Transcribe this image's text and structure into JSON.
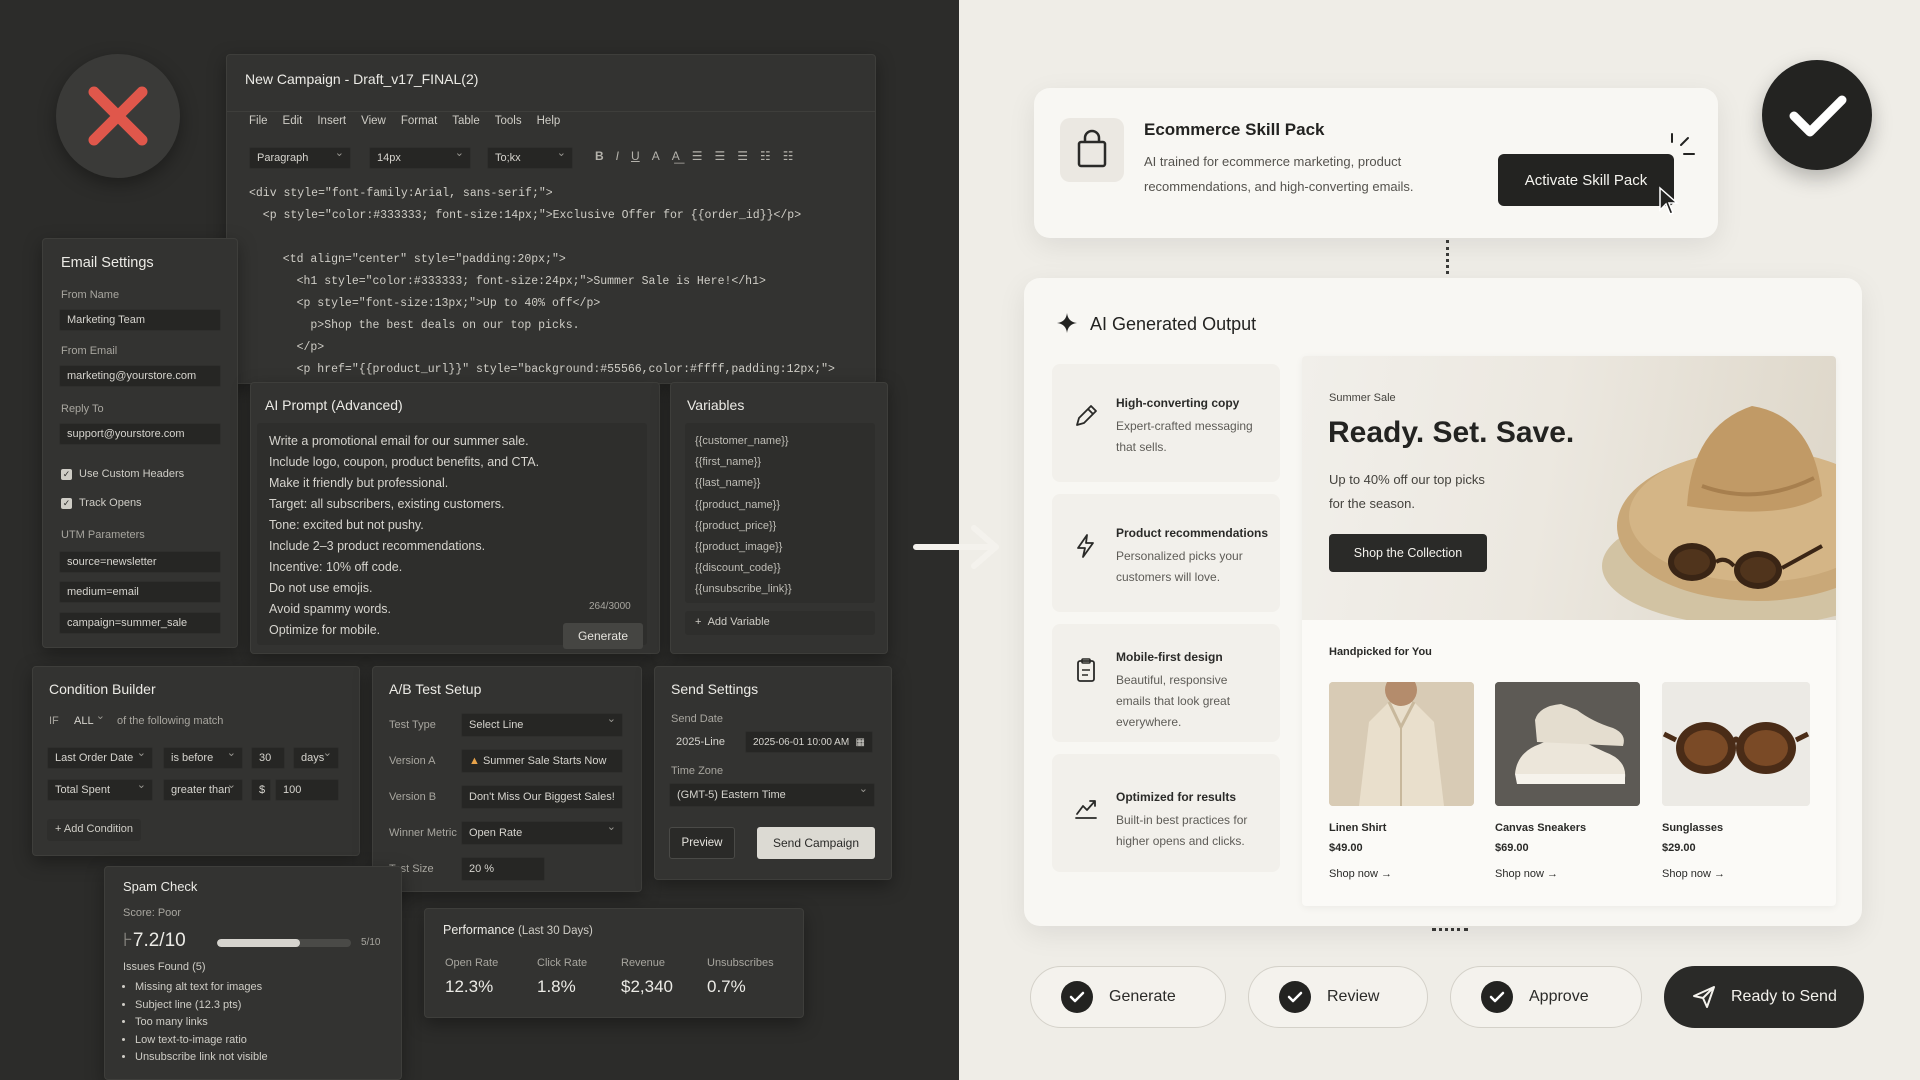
{
  "editor": {
    "title": "New Campaign - Draft_v17_FINAL(2)",
    "menu": [
      "File",
      "Edit",
      "Insert",
      "View",
      "Format",
      "Table",
      "Tools",
      "Help"
    ],
    "toolbar": {
      "paragraph": "Paragraph",
      "size": "14px",
      "font": "To;kx"
    },
    "code_lines": [
      "<div style=\"font-family:Arial, sans-serif;\">",
      "  <p style=\"color:#333333; font-size:14px;\">Exclusive Offer for {{order_id}}</p>",
      "",
      "  <td align=\"center\" style=\"padding:20px;\">",
      "    <h1 style=\"color:#333333; font-size:24px;\">Summer Sale is Here!</h1>",
      "    <p style=\"font-size:13px;\">Up to 40% off</p>",
      "      p>Shop the best deals on our top picks.",
      "    </p>",
      "    <p href=\"{{product_url}}\" style=\"background:#55566,color:#ffff,padding:12px;\">"
    ]
  },
  "email_settings": {
    "title": "Email Settings",
    "from_name_label": "From Name",
    "from_name": "Marketing Team",
    "from_email_label": "From Email",
    "from_email": "marketing@yourstore.com",
    "reply_to_label": "Reply To",
    "reply_to": "support@yourstore.com",
    "custom_headers": "Use Custom Headers",
    "track_opens": "Track Opens",
    "utm_label": "UTM Parameters",
    "utm": [
      "source=newsletter",
      "medium=email",
      "campaign=summer_sale"
    ]
  },
  "ai_prompt": {
    "title": "AI Prompt (Advanced)",
    "lines": [
      "Write a promotional email for our summer sale.",
      "Include logo, coupon, product benefits, and CTA.",
      "Make it friendly but professional.",
      "Target: all subscribers, existing customers.",
      "Tone: excited but not pushy.",
      "Include 2–3 product recommendations.",
      "Incentive: 10% off code.",
      "Do not use emojis.",
      "Avoid spammy words.",
      "Optimize for mobile."
    ],
    "counter": "264/3000",
    "generate": "Generate"
  },
  "variables": {
    "title": "Variables",
    "items": [
      "{{customer_name}}",
      "{{first_name}}",
      "{{last_name}}",
      "{{product_name}}",
      "{{product_price}}",
      "{{product_image}}",
      "{{discount_code}}",
      "{{unsubscribe_link}}"
    ],
    "add": "Add Variable"
  },
  "condition_builder": {
    "title": "Condition Builder",
    "if": "IF",
    "all": "ALL",
    "match": "of the following match",
    "row1": [
      "Last Order Date",
      "is before",
      "30",
      "days"
    ],
    "row2": [
      "Total Spent",
      "greater than",
      "$",
      "100"
    ],
    "add": "Add Condition"
  },
  "ab_test": {
    "title": "A/B Test Setup",
    "test_type_label": "Test Type",
    "test_type": "Select Line",
    "version_a_label": "Version A",
    "version_a": "Summer Sale Starts Now",
    "version_b_label": "Version B",
    "version_b": "Don't Miss Our Biggest Sales!",
    "metric_label": "Winner Metric",
    "metric": "Open Rate",
    "size_label": "Test Size",
    "size": "20 %"
  },
  "send_settings": {
    "title": "Send Settings",
    "send_date_label": "Send Date",
    "send_line": "2025-Line",
    "datetime": "2025-06-01 10:00 AM",
    "tz_label": "Time Zone",
    "tz": "(GMT-5) Eastern Time",
    "preview": "Preview",
    "send": "Send Campaign"
  },
  "spam": {
    "title": "Spam Check",
    "score_label": "Score: Poor",
    "score": "7.2/10",
    "bar_marker": "5/10",
    "bar_fill": 0.62,
    "issues_title": "Issues Found (5)",
    "issues": [
      "Missing alt text for images",
      "Subject line (12.3 pts)",
      "Too many links",
      "Low text-to-image ratio",
      "Unsubscribe link not visible"
    ]
  },
  "performance": {
    "title": "Performance",
    "period": "(Last 30 Days)",
    "metrics": [
      {
        "label": "Open Rate",
        "value": "12.3%"
      },
      {
        "label": "Click Rate",
        "value": "1.8%"
      },
      {
        "label": "Revenue",
        "value": "$2,340"
      },
      {
        "label": "Unsubscribes",
        "value": "0.7%"
      }
    ]
  },
  "skill_pack": {
    "title": "Ecommerce Skill Pack",
    "desc1": "AI trained for ecommerce marketing, product",
    "desc2": "recommendations, and high-converting emails.",
    "activate": "Activate Skill Pack"
  },
  "output": {
    "title": "AI Generated Output",
    "features": [
      {
        "title": "High-converting copy",
        "lines": [
          "Expert-crafted messaging",
          "that sells."
        ]
      },
      {
        "title": "Product recommendations",
        "lines": [
          "Personalized picks your",
          "customers will love."
        ]
      },
      {
        "title": "Mobile-first design",
        "lines": [
          "Beautiful, responsive",
          "emails that look great",
          "everywhere."
        ]
      },
      {
        "title": "Optimized for results",
        "lines": [
          "Built-in best practices for",
          "higher opens and clicks."
        ]
      }
    ],
    "hero": {
      "kicker": "Summer Sale",
      "headline": "Ready. Set. Save.",
      "sub1": "Up to 40% off our top picks",
      "sub2": "for the season.",
      "cta": "Shop the Collection"
    },
    "handpicked": "Handpicked for You",
    "products": [
      {
        "name": "Linen Shirt",
        "price": "$49.00",
        "link": "Shop now →"
      },
      {
        "name": "Canvas Sneakers",
        "price": "$69.00",
        "link": "Shop now →"
      },
      {
        "name": "Sunglasses",
        "price": "$29.00",
        "link": "Shop now →"
      }
    ]
  },
  "workflow": {
    "steps": [
      "Generate",
      "Review",
      "Approve"
    ],
    "final": "Ready to Send"
  },
  "colors": {
    "reject": "#e0574b",
    "accent_dark": "#232321"
  }
}
